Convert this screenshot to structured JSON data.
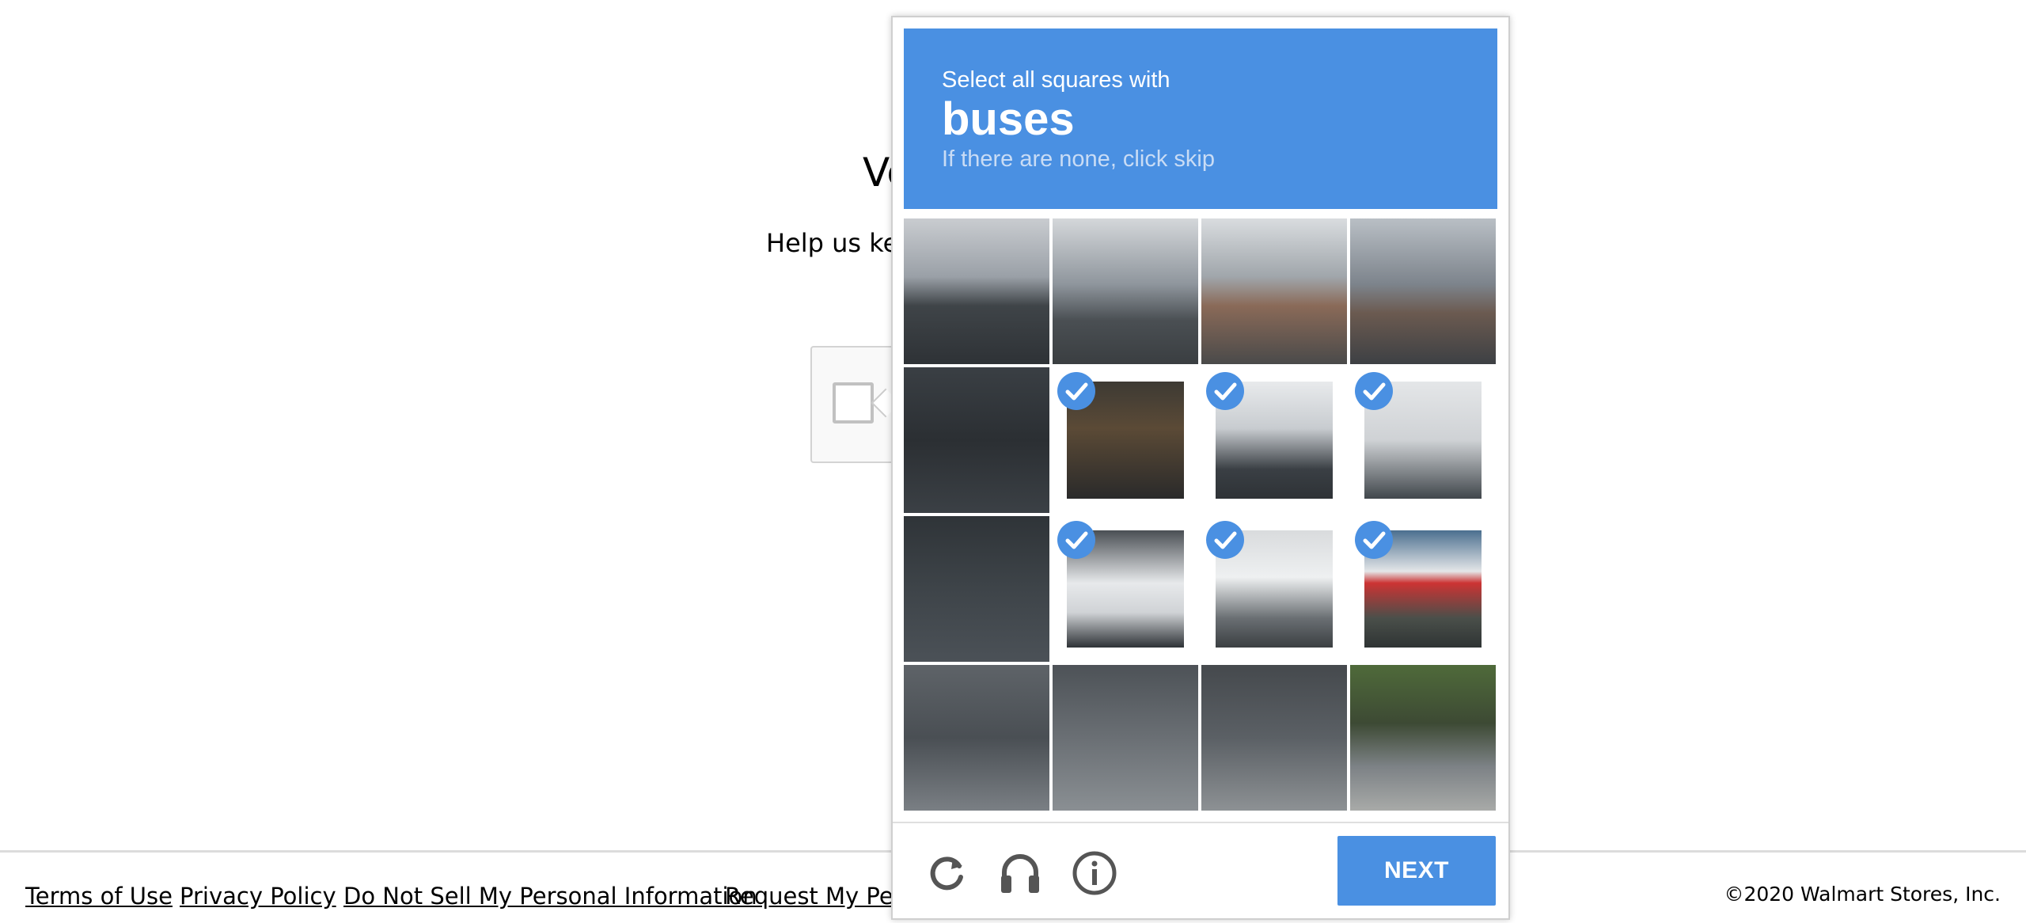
{
  "page": {
    "heading": "Ve",
    "subtext": "Help us kee"
  },
  "challenge": {
    "instruction_line1": "Select all squares with",
    "target_object": "buses",
    "instruction_line3": "If there are none, click skip",
    "next_label": "NEXT",
    "tiles": [
      {
        "selected": false
      },
      {
        "selected": false
      },
      {
        "selected": false
      },
      {
        "selected": false
      },
      {
        "selected": false
      },
      {
        "selected": true
      },
      {
        "selected": true
      },
      {
        "selected": true
      },
      {
        "selected": false
      },
      {
        "selected": true
      },
      {
        "selected": true
      },
      {
        "selected": true
      },
      {
        "selected": false
      },
      {
        "selected": false
      },
      {
        "selected": false
      },
      {
        "selected": false
      }
    ],
    "accent_color": "#4a90e2"
  },
  "footer": {
    "links": [
      "Terms of Use",
      "Privacy Policy",
      "Do Not Sell My Personal Information",
      "Request My Perso"
    ],
    "copyright": "©2020 Walmart Stores, Inc."
  }
}
